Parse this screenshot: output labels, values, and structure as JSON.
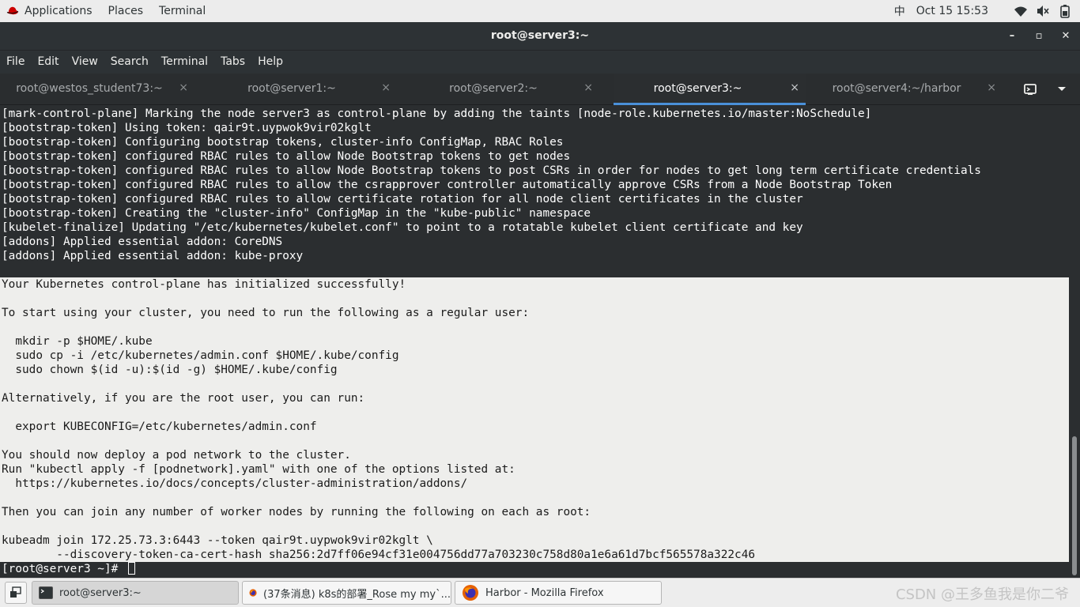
{
  "topbar": {
    "applications": "Applications",
    "places": "Places",
    "terminal": "Terminal",
    "input_method": "中",
    "clock": "Oct 15  15:53"
  },
  "window": {
    "title": "root@server3:~",
    "minimize": "–",
    "maximize": "▫",
    "close": "✕"
  },
  "menu": [
    "File",
    "Edit",
    "View",
    "Search",
    "Terminal",
    "Tabs",
    "Help"
  ],
  "tabs": [
    {
      "label": "root@westos_student73:~",
      "close": "×"
    },
    {
      "label": "root@server1:~",
      "close": "×"
    },
    {
      "label": "root@server2:~",
      "close": "×"
    },
    {
      "label": "root@server3:~",
      "close": "×"
    },
    {
      "label": "root@server4:~/harbor",
      "close": "×"
    }
  ],
  "terminal": {
    "pre_lines": [
      "[mark-control-plane] Marking the node server3 as control-plane by adding the taints [node-role.kubernetes.io/master:NoSchedule]",
      "[bootstrap-token] Using token: qair9t.uypwok9vir02kglt",
      "[bootstrap-token] Configuring bootstrap tokens, cluster-info ConfigMap, RBAC Roles",
      "[bootstrap-token] configured RBAC rules to allow Node Bootstrap tokens to get nodes",
      "[bootstrap-token] configured RBAC rules to allow Node Bootstrap tokens to post CSRs in order for nodes to get long term certificate credentials",
      "[bootstrap-token] configured RBAC rules to allow the csrapprover controller automatically approve CSRs from a Node Bootstrap Token",
      "[bootstrap-token] configured RBAC rules to allow certificate rotation for all node client certificates in the cluster",
      "[bootstrap-token] Creating the \"cluster-info\" ConfigMap in the \"kube-public\" namespace",
      "[kubelet-finalize] Updating \"/etc/kubernetes/kubelet.conf\" to point to a rotatable kubelet client certificate and key",
      "[addons] Applied essential addon: CoreDNS",
      "[addons] Applied essential addon: kube-proxy",
      ""
    ],
    "selected_lines": [
      "Your Kubernetes control-plane has initialized successfully!",
      "",
      "To start using your cluster, you need to run the following as a regular user:",
      "",
      "  mkdir -p $HOME/.kube",
      "  sudo cp -i /etc/kubernetes/admin.conf $HOME/.kube/config",
      "  sudo chown $(id -u):$(id -g) $HOME/.kube/config",
      "",
      "Alternatively, if you are the root user, you can run:",
      "",
      "  export KUBECONFIG=/etc/kubernetes/admin.conf",
      "",
      "You should now deploy a pod network to the cluster.",
      "Run \"kubectl apply -f [podnetwork].yaml\" with one of the options listed at:",
      "  https://kubernetes.io/docs/concepts/cluster-administration/addons/",
      "",
      "Then you can join any number of worker nodes by running the following on each as root:",
      "",
      "kubeadm join 172.25.73.3:6443 --token qair9t.uypwok9vir02kglt \\",
      "        --discovery-token-ca-cert-hash sha256:2d7ff06e94cf31e004756dd77a703230c758d80a1e6a61d7bcf565578a322c46"
    ],
    "prompt": "[root@server3 ~]# "
  },
  "taskbar": {
    "items": [
      {
        "label": "root@server3:~",
        "icon": "terminal-icon"
      },
      {
        "label": "(37条消息) k8s的部署_Rose my my`...",
        "icon": "firefox-icon"
      },
      {
        "label": "Harbor - Mozilla Firefox",
        "icon": "firefox-icon"
      }
    ],
    "watermark": "CSDN @王多鱼我是你二爷"
  }
}
